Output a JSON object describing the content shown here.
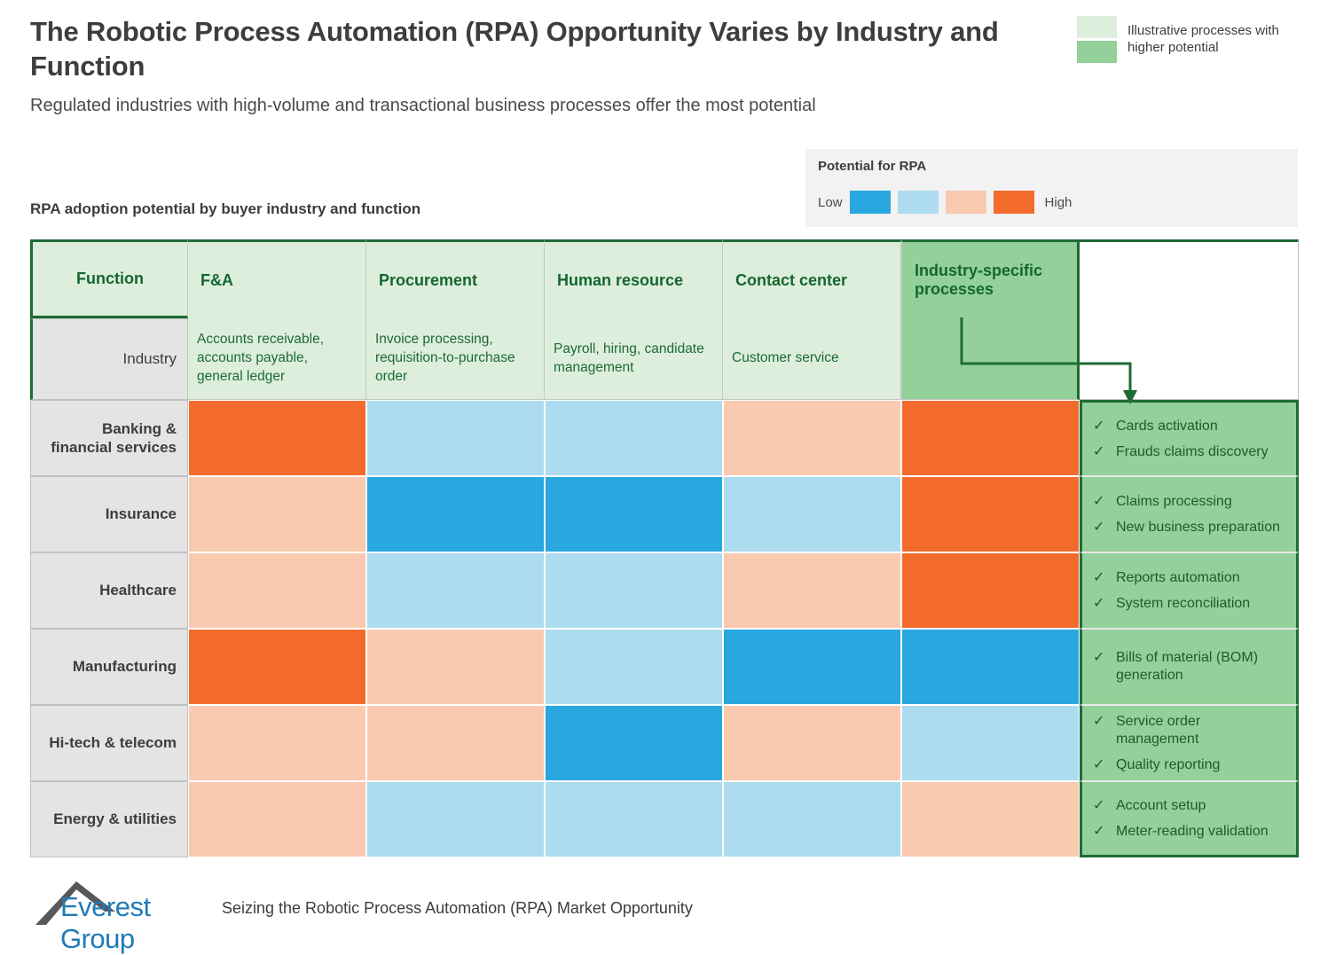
{
  "header": {
    "title": "The Robotic Process Automation (RPA) Opportunity Varies by Industry and Function",
    "subtitle": "Regulated industries with high-volume and transactional business processes offer the most potential",
    "section_label": "RPA adoption potential by buyer industry and function"
  },
  "legend": {
    "title": "Potential for RPA",
    "low_label": "Low",
    "high_label": "High",
    "swatches": [
      "#28a8de",
      "#addcf0",
      "#f9cab0",
      "#f26b2c"
    ],
    "illustrative_text": "Illustrative processes with higher potential",
    "illustrative_swatches": [
      "#ddeedd",
      "#93d09a"
    ]
  },
  "colors": {
    "very_low": "#28a8de",
    "low": "#addcf0",
    "medium": "#f9cab0",
    "high": "#f26b2c",
    "header_green": "#ddeedd",
    "accent_green": "#93d09a",
    "border_green": "#1e6b36",
    "row_label_gray": "#e4e4e4"
  },
  "table": {
    "columns": [
      {
        "key": "function",
        "label": "Function"
      },
      {
        "key": "fa",
        "label": "F&A"
      },
      {
        "key": "procurement",
        "label": "Procurement"
      },
      {
        "key": "hr",
        "label": "Human resource"
      },
      {
        "key": "contact",
        "label": "Contact center"
      },
      {
        "key": "isp",
        "label": "Industry-specific processes"
      }
    ],
    "industry_row": {
      "label": "Industry",
      "cells": [
        "Accounts receivable, accounts payable, general ledger",
        "Invoice processing, requisition-to-purchase order",
        "Payroll, hiring, candidate management",
        "Customer service",
        ""
      ]
    },
    "rows": [
      {
        "industry": "Banking & financial services",
        "heat": [
          "high",
          "low",
          "low",
          "medium",
          "high"
        ],
        "processes": [
          "Cards activation",
          "Frauds claims discovery"
        ]
      },
      {
        "industry": "Insurance",
        "heat": [
          "medium",
          "very_low",
          "very_low",
          "low",
          "high"
        ],
        "processes": [
          "Claims processing",
          "New business preparation"
        ]
      },
      {
        "industry": "Healthcare",
        "heat": [
          "medium",
          "low",
          "low",
          "medium",
          "high"
        ],
        "processes": [
          "Reports automation",
          "System reconciliation"
        ]
      },
      {
        "industry": "Manufacturing",
        "heat": [
          "high",
          "medium",
          "low",
          "very_low",
          "very_low"
        ],
        "processes": [
          "Bills of material (BOM) generation"
        ]
      },
      {
        "industry": "Hi-tech & telecom",
        "heat": [
          "medium",
          "medium",
          "very_low",
          "medium",
          "low"
        ],
        "processes": [
          "Service order management",
          "Quality reporting"
        ]
      },
      {
        "industry": "Energy & utilities",
        "heat": [
          "medium",
          "low",
          "low",
          "low",
          "medium"
        ],
        "processes": [
          "Account setup",
          "Meter-reading validation"
        ]
      }
    ],
    "check_glyph": "✓"
  },
  "footer": {
    "logo_name": "Everest Group",
    "text": "Seizing the Robotic Process Automation (RPA) Market Opportunity"
  }
}
